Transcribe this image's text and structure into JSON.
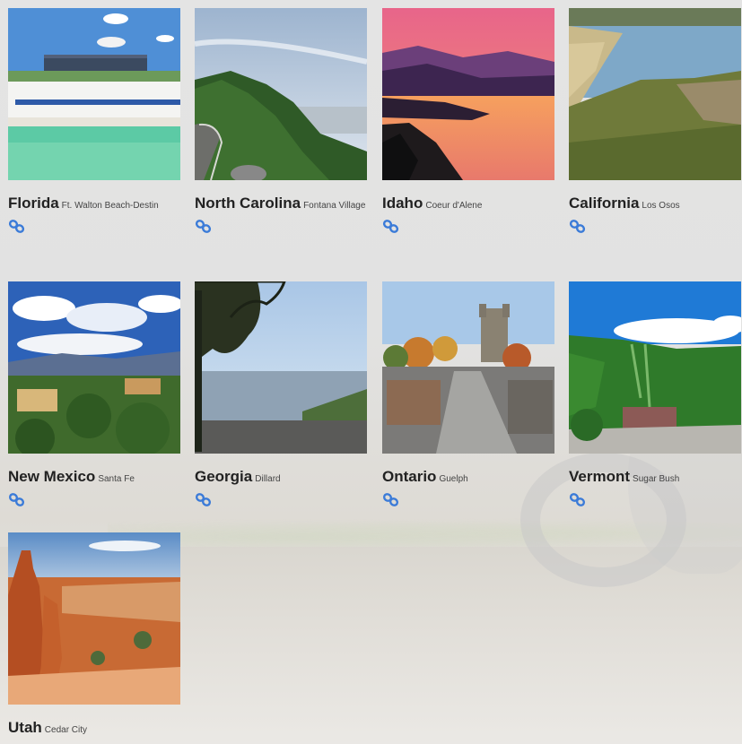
{
  "colors": {
    "link_icon": "#3b7bd8",
    "state_text": "#222222",
    "city_text": "#444444"
  },
  "destinations": [
    {
      "state": "Florida",
      "city": "Ft. Walton Beach-Destin",
      "icon": "link-icon"
    },
    {
      "state": "North Carolina",
      "city": "Fontana Village",
      "icon": "link-icon"
    },
    {
      "state": "Idaho",
      "city": "Coeur d'Alene",
      "icon": "link-icon"
    },
    {
      "state": "California",
      "city": "Los Osos",
      "icon": "link-icon"
    },
    {
      "state": "New Mexico",
      "city": "Santa Fe",
      "icon": "link-icon"
    },
    {
      "state": "Georgia",
      "city": "Dillard",
      "icon": "link-icon"
    },
    {
      "state": "Ontario",
      "city": "Guelph",
      "icon": "link-icon"
    },
    {
      "state": "Vermont",
      "city": "Sugar Bush",
      "icon": "link-icon"
    },
    {
      "state": "Utah",
      "city": "Cedar City",
      "icon": "link-icon"
    }
  ]
}
